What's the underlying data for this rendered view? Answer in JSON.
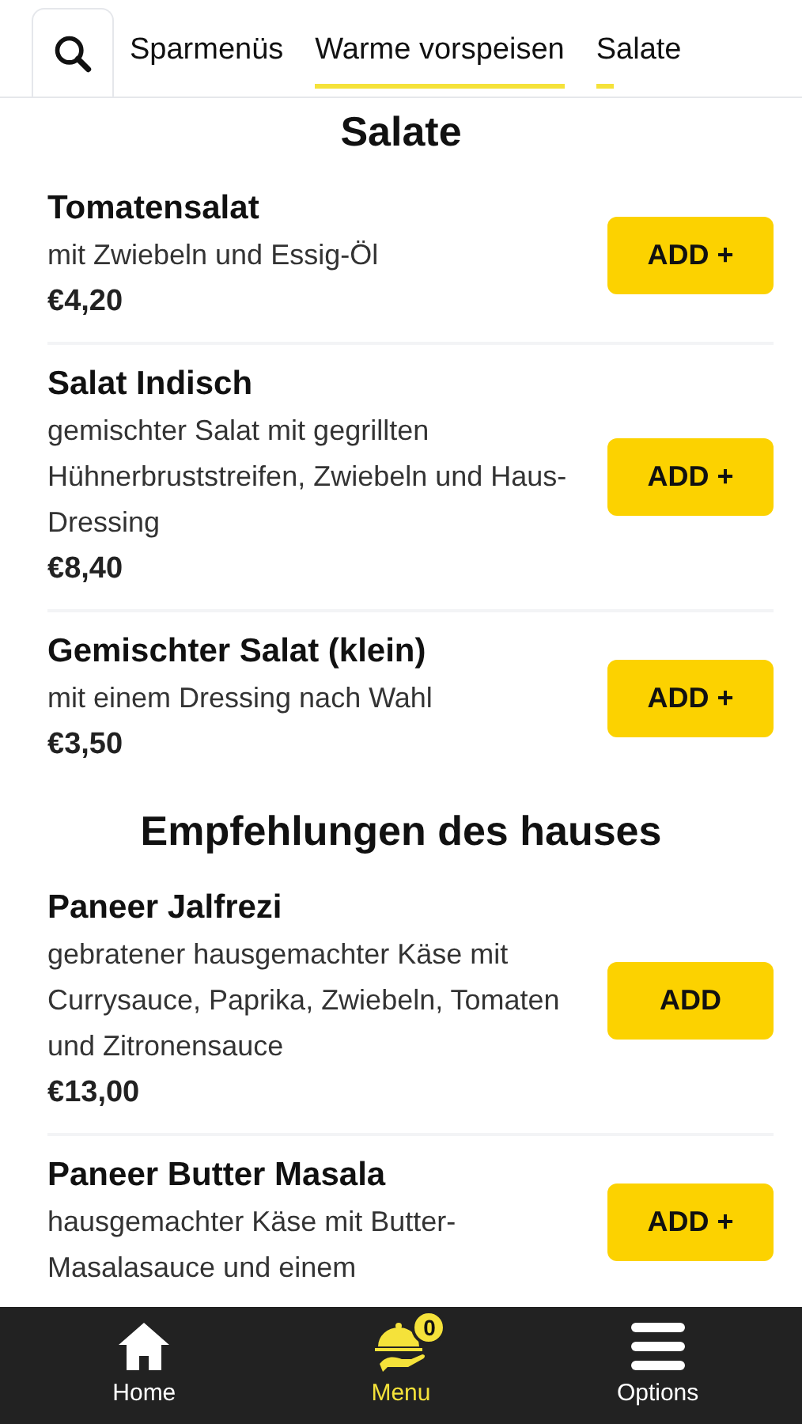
{
  "tabs": [
    {
      "label": "Sparmenüs"
    },
    {
      "label": "Warme vorspeisen",
      "level": 1
    },
    {
      "label": "Salate",
      "level": 0.2
    }
  ],
  "sections": [
    {
      "title": "Salate",
      "items": [
        {
          "name": "Tomatensalat",
          "description": "mit Zwiebeln und Essig-Öl",
          "price": "€4,20",
          "button": "ADD +"
        },
        {
          "name": "Salat Indisch",
          "description": "gemischter Salat mit gegrillten Hühnerbruststreifen, Zwiebeln und Haus-Dressing",
          "price": "€8,40",
          "button": "ADD +"
        },
        {
          "name": "Gemischter Salat (klein)",
          "description": "mit einem Dressing nach Wahl",
          "price": "€3,50",
          "button": "ADD +"
        }
      ]
    },
    {
      "title": "Empfehlungen des hauses",
      "items": [
        {
          "name": "Paneer Jalfrezi",
          "description": "gebratener hausgemachter Käse mit Currysauce, Paprika, Zwiebeln, Tomaten und Zitronensauce",
          "price": "€13,00",
          "button": "ADD"
        },
        {
          "name": "Paneer Butter Masala",
          "description": "hausgemachter Käse mit Butter-Masalasauce und einem",
          "button": "ADD +"
        }
      ]
    }
  ],
  "bottom_nav": [
    {
      "kind": "home",
      "label": "Home",
      "selected": false
    },
    {
      "kind": "menu",
      "label": "Menu",
      "selected": true,
      "badge": "0"
    },
    {
      "kind": "options",
      "label": "Options",
      "selected": false
    }
  ]
}
